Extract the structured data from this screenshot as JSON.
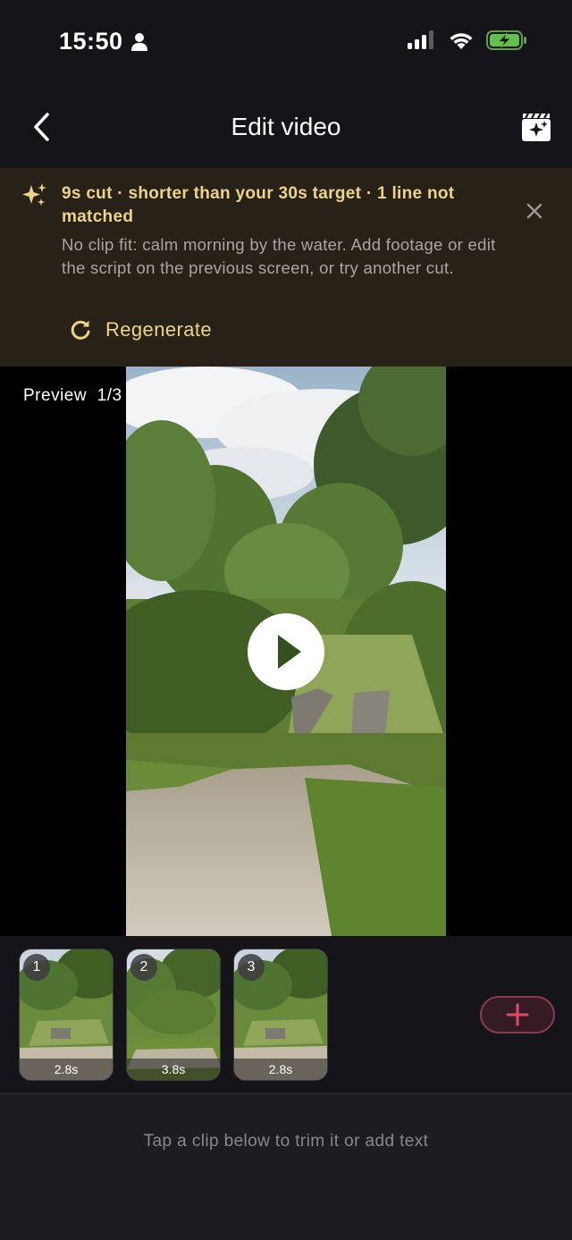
{
  "status_bar": {
    "time": "15:50"
  },
  "nav": {
    "title": "Edit video",
    "back_icon": "chevron-left-icon",
    "action_icon": "magic-clapperboard-icon"
  },
  "notice": {
    "title": "9s cut · shorter than your 30s target · 1 line not matched",
    "body": "No clip fit: calm morning by the water. Add footage or edit the script on the previous screen, or try another cut.",
    "action_label": "Regenerate",
    "accent_color": "#ecd489",
    "background_color": "#272117"
  },
  "preview": {
    "label": "Preview",
    "counter": "1/3"
  },
  "clips": [
    {
      "number": "1",
      "duration": "2.8s"
    },
    {
      "number": "2",
      "duration": "3.8s"
    },
    {
      "number": "3",
      "duration": "2.8s"
    }
  ],
  "add_clip_color": "#e04a6a",
  "hint": "Tap a clip below to trim it or add text"
}
